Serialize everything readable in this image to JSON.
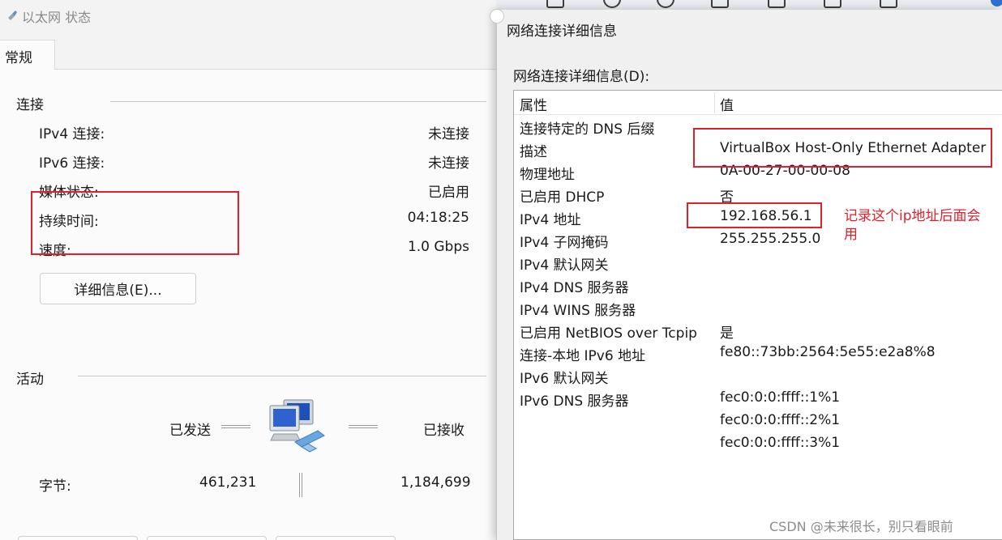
{
  "status_window": {
    "title": "以太网 状态",
    "tab_general": "常规",
    "connection": {
      "heading": "连接",
      "rows": [
        {
          "label": "IPv4 连接:",
          "value": "未连接"
        },
        {
          "label": "IPv6 连接:",
          "value": "未连接"
        },
        {
          "label": "媒体状态:",
          "value": "已启用"
        },
        {
          "label": "持续时间:",
          "value": "04:18:25"
        },
        {
          "label": "速度:",
          "value": "1.0 Gbps"
        }
      ],
      "details_button": "详细信息(E)..."
    },
    "activity": {
      "heading": "活动",
      "sent_label": "已发送",
      "received_label": "已接收",
      "bytes_label": "字节:",
      "bytes_sent": "461,231",
      "bytes_received": "1,184,699"
    }
  },
  "details_dialog": {
    "title": "网络连接详细信息",
    "list_label": "网络连接详细信息(D):",
    "columns": {
      "property": "属性",
      "value": "值"
    },
    "rows": [
      {
        "property": "连接特定的 DNS 后缀",
        "value": ""
      },
      {
        "property": "描述",
        "value": "VirtualBox Host-Only Ethernet Adapter"
      },
      {
        "property": "物理地址",
        "value": "0A-00-27-00-00-08"
      },
      {
        "property": "已启用 DHCP",
        "value": "否"
      },
      {
        "property": "IPv4 地址",
        "value": "192.168.56.1"
      },
      {
        "property": "IPv4 子网掩码",
        "value": "255.255.255.0"
      },
      {
        "property": "IPv4 默认网关",
        "value": ""
      },
      {
        "property": "IPv4 DNS 服务器",
        "value": ""
      },
      {
        "property": "IPv4 WINS 服务器",
        "value": ""
      },
      {
        "property": "已启用 NetBIOS over Tcpip",
        "value": "是"
      },
      {
        "property": "连接-本地 IPv6 地址",
        "value": "fe80::73bb:2564:5e55:e2a8%8"
      },
      {
        "property": "IPv6 默认网关",
        "value": ""
      },
      {
        "property": "IPv6 DNS 服务器",
        "value": "fec0:0:0:ffff::1%1"
      },
      {
        "property": "",
        "value": "fec0:0:0:ffff::2%1"
      },
      {
        "property": "",
        "value": "fec0:0:0:ffff::3%1"
      }
    ]
  },
  "annotation": {
    "note": "记录这个ip地址后面会用",
    "color": "#e0202a"
  },
  "watermark": "CSDN @未来很长，别只看眼前",
  "icons": {
    "title": "ethernet-cable-icon",
    "activity": "network-computers-icon",
    "close": "close-icon"
  }
}
